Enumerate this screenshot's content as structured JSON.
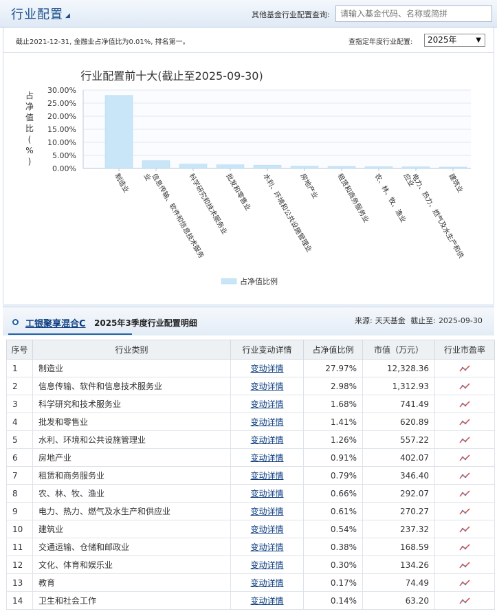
{
  "header": {
    "title": "行业配置",
    "search_label": "其他基金行业配置查询:",
    "search_placeholder": "请输入基金代码、名称或简拼"
  },
  "info": {
    "text": "截止2021-12-31, 金融业占净值比为0.01%, 排名第一。",
    "year_label": "查指定年度行业配置:",
    "year_selected": "2025年"
  },
  "chart_data": {
    "type": "bar",
    "title": "行业配置前十大(截止至2025-09-30)",
    "ylabel": "占净值比(%)",
    "ylim": [
      0,
      30
    ],
    "yticks": [
      "0.00%",
      "5.00%",
      "10.00%",
      "15.00%",
      "20.00%",
      "25.00%",
      "30.00%"
    ],
    "grid": true,
    "legend_position": "bottom",
    "series": [
      {
        "name": "占净值比例",
        "color": "#c8e6f7",
        "values": [
          27.97,
          2.98,
          1.68,
          1.41,
          1.26,
          0.91,
          0.79,
          0.66,
          0.61,
          0.54
        ]
      }
    ],
    "categories": [
      "制造业",
      "信息传输、软件和信息技术服务业",
      "科学研究和技术服务业",
      "批发和零售业",
      "水利、环境和公共设施管理业",
      "房地产业",
      "租赁和商务服务业",
      "农、林、牧、渔业",
      "电力、热力、燃气及水生产和供应业",
      "建筑业"
    ]
  },
  "section": {
    "fund_name": "工银聚享混合C",
    "title": "2025年3季度行业配置明细",
    "source_label": "来源:",
    "source_value": "天天基金",
    "cutoff_label": "截止至:",
    "cutoff_value": "2025-09-30"
  },
  "table": {
    "headers": [
      "序号",
      "行业类别",
      "行业变动详情",
      "占净值比例",
      "市值（万元）",
      "行业市盈率"
    ],
    "link_label": "变动详情",
    "rows": [
      {
        "idx": "1",
        "name": "制造业",
        "pct": "27.97%",
        "value": "12,328.36"
      },
      {
        "idx": "2",
        "name": "信息传输、软件和信息技术服务业",
        "pct": "2.98%",
        "value": "1,312.93"
      },
      {
        "idx": "3",
        "name": "科学研究和技术服务业",
        "pct": "1.68%",
        "value": "741.49"
      },
      {
        "idx": "4",
        "name": "批发和零售业",
        "pct": "1.41%",
        "value": "620.89"
      },
      {
        "idx": "5",
        "name": "水利、环境和公共设施管理业",
        "pct": "1.26%",
        "value": "557.22"
      },
      {
        "idx": "6",
        "name": "房地产业",
        "pct": "0.91%",
        "value": "402.07"
      },
      {
        "idx": "7",
        "name": "租赁和商务服务业",
        "pct": "0.79%",
        "value": "346.40"
      },
      {
        "idx": "8",
        "name": "农、林、牧、渔业",
        "pct": "0.66%",
        "value": "292.07"
      },
      {
        "idx": "9",
        "name": "电力、热力、燃气及水生产和供应业",
        "pct": "0.61%",
        "value": "270.27"
      },
      {
        "idx": "10",
        "name": "建筑业",
        "pct": "0.54%",
        "value": "237.32"
      },
      {
        "idx": "11",
        "name": "交通运输、仓储和邮政业",
        "pct": "0.38%",
        "value": "168.59"
      },
      {
        "idx": "12",
        "name": "文化、体育和娱乐业",
        "pct": "0.30%",
        "value": "134.26"
      },
      {
        "idx": "13",
        "name": "教育",
        "pct": "0.17%",
        "value": "74.49"
      },
      {
        "idx": "14",
        "name": "卫生和社会工作",
        "pct": "0.14%",
        "value": "63.20"
      }
    ]
  },
  "icons": {
    "pe_icon": "trend-chart-icon",
    "dot_icon": "section-bullet-icon"
  }
}
